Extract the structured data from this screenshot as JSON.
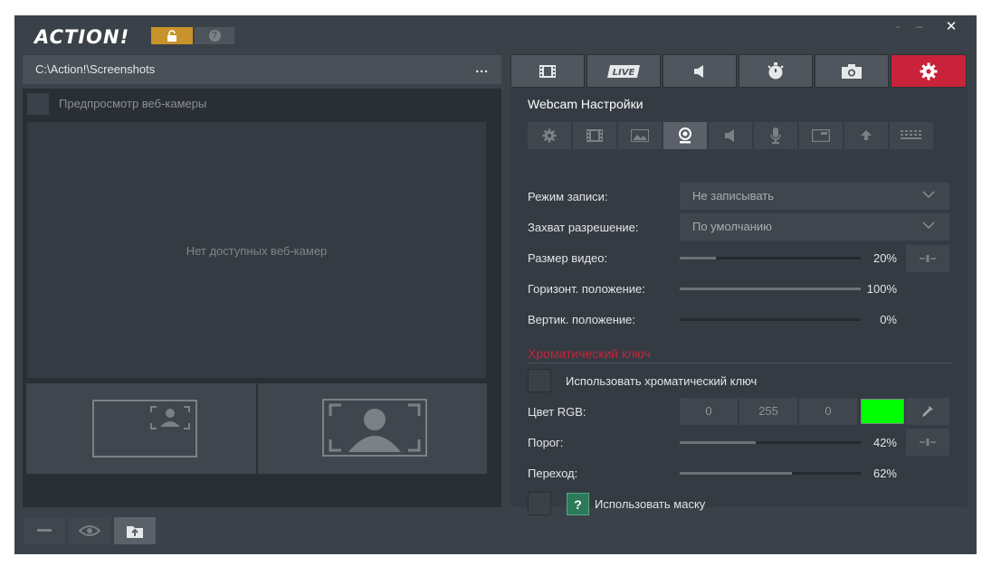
{
  "app": {
    "logo": "ACTION!",
    "window_controls": {
      "menu": "-",
      "minimize": "–",
      "close": "✕"
    }
  },
  "left": {
    "path": "C:\\Action!\\Screenshots",
    "more_label": "...",
    "preview_label": "Предпросмотр веб-камеры",
    "no_cameras": "Нет доступных веб-камер"
  },
  "top_tabs": [
    {
      "icon": "film-icon"
    },
    {
      "icon": "live-icon",
      "label": "LIVE"
    },
    {
      "icon": "speaker-icon"
    },
    {
      "icon": "stopwatch-icon"
    },
    {
      "icon": "camera-icon"
    },
    {
      "icon": "gear-icon",
      "active": true
    }
  ],
  "settings": {
    "title": "Webcam Настройки",
    "recording_mode": {
      "label": "Режим записи:",
      "value": "Не записывать"
    },
    "capture_resolution": {
      "label": "Захват разрешение:",
      "value": "По умолчанию"
    },
    "video_size": {
      "label": "Размер видео:",
      "value": "20%",
      "level": 0.2
    },
    "horizontal_position": {
      "label": "Горизонт. положение:",
      "value": "100%",
      "level": 1.0
    },
    "vertical_position": {
      "label": "Вертик. положение:",
      "value": "0%",
      "level": 0.0
    },
    "chroma_section": "Хроматический ключ",
    "use_chroma": "Использовать хроматический ключ",
    "rgb": {
      "label": "Цвет RGB:",
      "r": "0",
      "g": "255",
      "b": "0",
      "swatch_color": "#00ff00"
    },
    "threshold": {
      "label": "Порог:",
      "value": "42%",
      "level": 0.42
    },
    "transition": {
      "label": "Переход:",
      "value": "62%",
      "level": 0.62
    },
    "use_mask": "Использовать маску",
    "help_glyph": "?"
  },
  "colors": {
    "accent": "#c8233a",
    "lock": "#c8932a",
    "help_green": "#2c7a5a"
  }
}
